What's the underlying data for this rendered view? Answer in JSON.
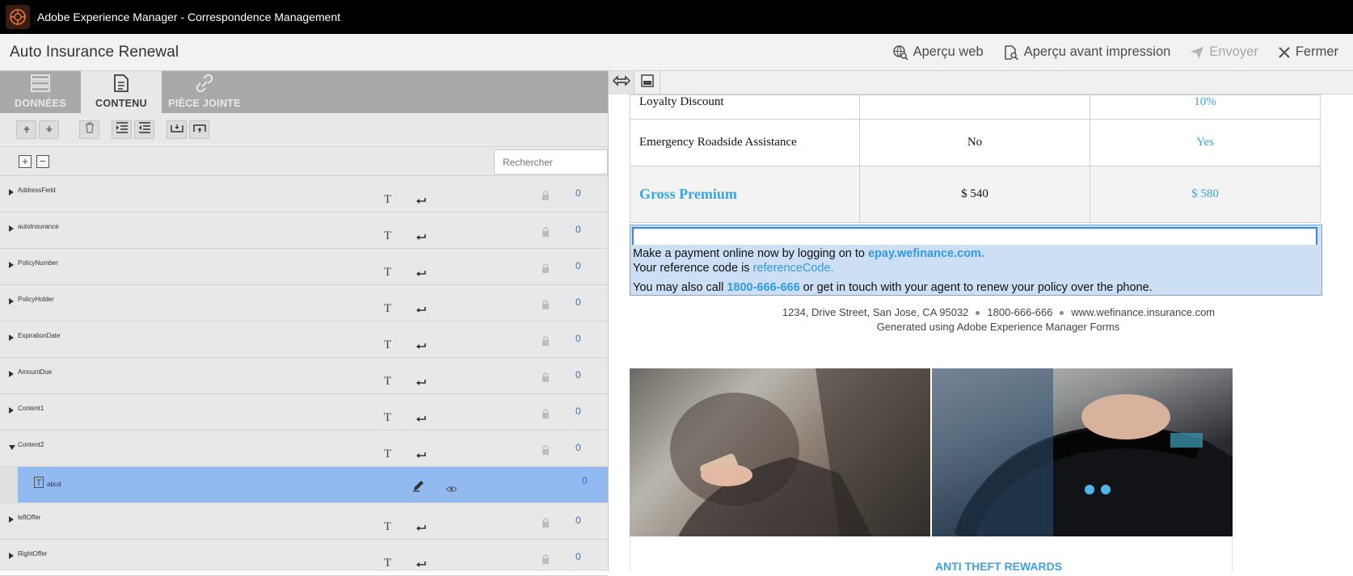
{
  "app": {
    "title": "Adobe Experience Manager - Correspondence Management"
  },
  "header": {
    "doc_title": "Auto Insurance Renewal",
    "actions": [
      {
        "label": "Aperçu web",
        "icon": "globe-search-icon"
      },
      {
        "label": "Aperçu avant impression",
        "icon": "doc-search-icon"
      },
      {
        "label": "Envoyer",
        "icon": "send-icon",
        "disabled": true
      },
      {
        "label": "Fermer",
        "icon": "close-icon"
      }
    ]
  },
  "left": {
    "tabs": [
      {
        "label": "DONNÉES",
        "icon": "data-icon"
      },
      {
        "label": "CONTENU",
        "icon": "content-icon",
        "active": true
      },
      {
        "label": "PIÈCE JOINTE",
        "icon": "attachment-icon"
      }
    ],
    "search_placeholder": "Rechercher",
    "rows": [
      {
        "label": "AddressField",
        "count": "0"
      },
      {
        "label": "autoInsurance",
        "count": "0"
      },
      {
        "label": "PolicyNumber",
        "count": "0"
      },
      {
        "label": "PolicyHolder",
        "count": "0"
      },
      {
        "label": "ExpirationDate",
        "count": "0"
      },
      {
        "label": "AmountDue",
        "count": "0"
      },
      {
        "label": "Content1",
        "count": "0"
      },
      {
        "label": "Content2",
        "count": "0",
        "expanded": true
      },
      {
        "label": "abcd",
        "count": "0",
        "child": true,
        "selected": true
      },
      {
        "label": "leftOffer",
        "count": "0"
      },
      {
        "label": "RightOffer",
        "count": "0"
      }
    ],
    "row_type_glyph": "T"
  },
  "right": {
    "table": {
      "rows": [
        {
          "label": "Loyalty Discount",
          "current": "",
          "renewal": "10%"
        },
        {
          "label": "Emergency Roadside Assistance",
          "current": "No",
          "renewal": "Yes"
        },
        {
          "label": "Gross Premium",
          "current": "$ 540",
          "renewal": "$ 580"
        }
      ]
    },
    "payment": {
      "line1_prefix": "Make a payment online now by logging on to ",
      "line1_link": "epay.wefinance.com.",
      "line2_prefix": "Your reference code is ",
      "line2_link": "referenceCode.",
      "line3_prefix": "You may also call ",
      "line3_phone": "1800-666-666",
      "line3_suffix": " or get in touch with your agent to renew your policy over the phone."
    },
    "footer": {
      "address": "1234, Drive Street, San Jose, CA 95032",
      "phone": "1800-666-666",
      "website": "www.wefinance.insurance.com",
      "generated": "Generated using Adobe Experience Manager Forms"
    },
    "offer_caption": "ANTI THEFT REWARDS"
  },
  "colors": {
    "accent": "#3aa3e6",
    "selection": "#93b9f1"
  }
}
